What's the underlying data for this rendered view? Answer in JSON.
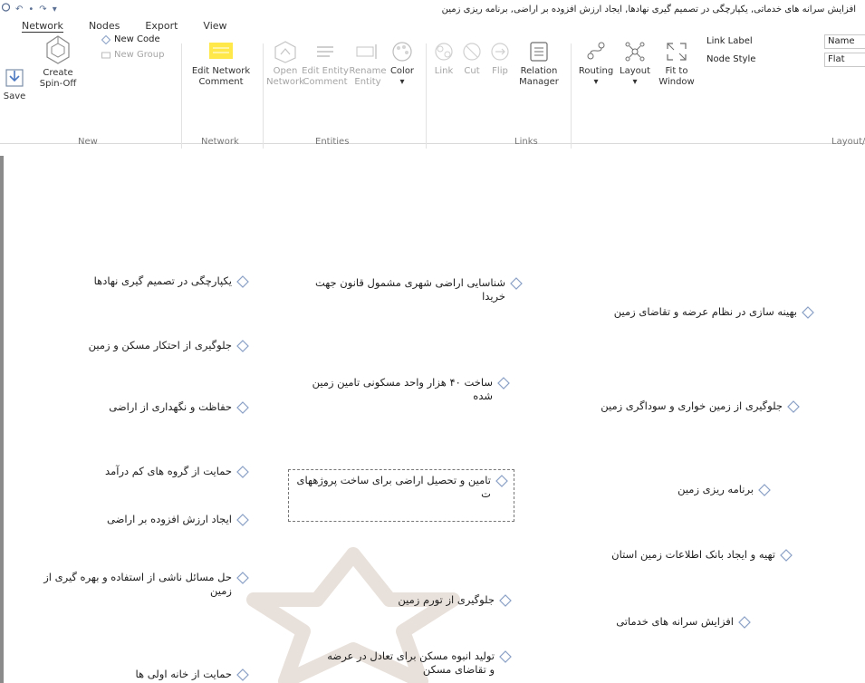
{
  "window": {
    "title": "افزایش سرانه های خدماتی, یکپارچگی در تصمیم گیری نهادها, ایجاد ارزش افزوده بر اراضی, برنامه ریزی زمین"
  },
  "quick_access": [
    "app-icon",
    "undo-icon",
    "redo-icon",
    "customize-icon"
  ],
  "tabs": [
    {
      "label": "Network",
      "active": true
    },
    {
      "label": "Nodes",
      "active": false
    },
    {
      "label": "Export",
      "active": false
    },
    {
      "label": "View",
      "active": false
    }
  ],
  "ribbon": {
    "new_group": {
      "label": "New",
      "save": "Save",
      "create_spin_off_1": "Create",
      "create_spin_off_2": "Spin-Off",
      "new_code": "New Code",
      "new_group_btn": "New Group"
    },
    "network_group": {
      "label": "Network",
      "edit_network_comment_1": "Edit Network",
      "edit_network_comment_2": "Comment"
    },
    "entities_group": {
      "label": "Entities",
      "open_network_1": "Open",
      "open_network_2": "Network",
      "edit_entity_comment_1": "Edit Entity",
      "edit_entity_comment_2": "Comment",
      "rename_entity_1": "Rename",
      "rename_entity_2": "Entity",
      "color": "Color",
      "color_arrow": "▾"
    },
    "links_group": {
      "label": "Links",
      "link": "Link",
      "cut": "Cut",
      "flip": "Flip",
      "relation_manager_1": "Relation",
      "relation_manager_2": "Manager"
    },
    "layout_group": {
      "label": "Layout/",
      "routing": "Routing",
      "routing_arrow": "▾",
      "layout": "Layout",
      "layout_arrow": "▾",
      "fit_to_window_1": "Fit to",
      "fit_to_window_2": "Window",
      "link_label": "Link Label",
      "link_label_value": "Name",
      "node_style": "Node Style",
      "node_style_value": "Flat"
    }
  },
  "nodes": [
    {
      "text": "یکپارچگی در تصمیم گیری نهادها",
      "selected": false
    },
    {
      "text": "جلوگیری از احتکار مسکن و زمین",
      "selected": false
    },
    {
      "text": "حفاظت و نگهداری از اراضی",
      "selected": false
    },
    {
      "text": "حمایت از گروه های کم درآمد",
      "selected": false
    },
    {
      "text": "ایجاد ارزش افزوده بر اراضی",
      "selected": false
    },
    {
      "text": "حل مسائل ناشی از استفاده و بهره گیری از زمین",
      "selected": false
    },
    {
      "text": "حمایت از خانه اولی ها",
      "selected": false
    },
    {
      "text": "شناسایی اراضی شهری مشمول قانون جهت خریدا",
      "selected": false
    },
    {
      "text": "ساخت ۴۰ هزار واحد مسکونی تامین زمین شده",
      "selected": false
    },
    {
      "text": "تامین و تحصیل اراضی برای ساخت پروژههای ت",
      "selected": true
    },
    {
      "text": "جلوگیری از تورم زمین",
      "selected": false
    },
    {
      "text": "تولید انبوه مسکن برای تعادل در عرضه و تقاضای مسکن",
      "selected": false
    },
    {
      "text": "بهینه سازی در نظام عرضه و تقاضای زمین",
      "selected": false
    },
    {
      "text": "جلوگیری از زمین خواری و سوداگری زمین",
      "selected": false
    },
    {
      "text": "برنامه ریزی زمین",
      "selected": false
    },
    {
      "text": "تهیه و ایجاد بانک اطلاعات زمین استان",
      "selected": false
    },
    {
      "text": "افزایش سرانه های خدماتی",
      "selected": false
    }
  ],
  "colors": {
    "accent": "#2a5699",
    "icon_gray": "#7a7a7a",
    "icon_disabled": "#b9b9b9",
    "comment_yellow": "#ffe84a",
    "diamond_fill": "#ffffff",
    "diamond_stroke": "#8aa0c6"
  }
}
